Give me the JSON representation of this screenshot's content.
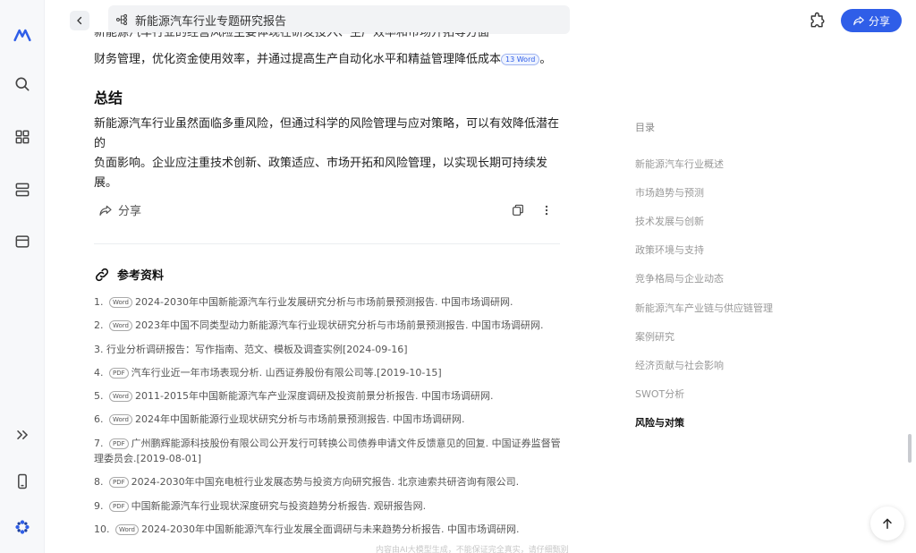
{
  "header": {
    "title": "新能源汽车行业专题研究报告",
    "share_label": "分享"
  },
  "article": {
    "cut_line": "新能源汽车行业的经营风险主要体现在研发投入、生产效率和市场开拓等方面",
    "para1_text": "财务管理，优化资金使用效率，并通过提高生产自动化水平和精益管理降低成本",
    "para1_cite": "13 Word",
    "summary_heading": "总结",
    "summary_line1": "新能源汽车行业虽然面临多重风险，但通过科学的风险管理与应对策略，可以有效降低潜在的",
    "summary_line2": "负面影响。企业应注重技术创新、政策适应、市场开拓和风险管理，以实现长期可持续发展。",
    "share_label": "分享"
  },
  "references": {
    "heading": "参考资料",
    "items": [
      {
        "num": "1.",
        "tag": "Word",
        "text": "2024-2030年中国新能源汽车行业发展研究分析与市场前景预测报告. 中国市场调研网."
      },
      {
        "num": "2.",
        "tag": "Word",
        "text": "2023年中国不同类型动力新能源汽车行业现状研究分析与市场前景预测报告. 中国市场调研网."
      },
      {
        "num": "3.",
        "tag": "",
        "text": "行业分析调研报告：写作指南、范文、模板及调查实例[2024-09-16]"
      },
      {
        "num": "4.",
        "tag": "PDF",
        "text": "汽车行业近一年市场表现分析. 山西证券股份有限公司等.[2019-10-15]"
      },
      {
        "num": "5.",
        "tag": "Word",
        "text": "2011-2015年中国新能源汽车产业深度调研及投资前景分析报告. 中国市场调研网."
      },
      {
        "num": "6.",
        "tag": "Word",
        "text": "2024年中国新能源行业现状研究分析与市场前景预测报告. 中国市场调研网."
      },
      {
        "num": "7.",
        "tag": "PDF",
        "text": "广州鹏辉能源科技股份有限公司公开发行可转换公司债券申请文件反馈意见的回复. 中国证券监督管",
        "text2": "理委员会.[2019-08-01]"
      },
      {
        "num": "8.",
        "tag": "PDF",
        "text": "2024-2030年中国充电桩行业发展态势与投资方向研究报告. 北京迪索共研咨询有限公司."
      },
      {
        "num": "9.",
        "tag": "PDF",
        "text": "中国新能源汽车行业现状深度研究与投资趋势分析报告. 观研报告网."
      },
      {
        "num": "10.",
        "tag": "Word",
        "text": "2024-2030年中国新能源汽车行业发展全面调研与未来趋势分析报告. 中国市场调研网."
      }
    ]
  },
  "footer_note": "内容由AI大模型生成，不能保证完全真实，请仔细甄别",
  "toc": {
    "title": "目录",
    "items": [
      {
        "label": "新能源汽车行业概述"
      },
      {
        "label": "市场趋势与预测"
      },
      {
        "label": "技术发展与创新"
      },
      {
        "label": "政策环境与支持"
      },
      {
        "label": "竞争格局与企业动态"
      },
      {
        "label": "新能源汽车产业链与供应链管理"
      },
      {
        "label": "案例研究"
      },
      {
        "label": "经济贡献与社会影响"
      },
      {
        "label": "SWOT分析"
      },
      {
        "label": "风险与对策"
      }
    ],
    "active_index": 9
  },
  "colors": {
    "accent": "#2f5ee8",
    "toc_active": "#111111",
    "toc_inactive": "#999999"
  },
  "icons": [
    "logo-icon",
    "search-icon",
    "grid-icon",
    "stack-icon",
    "window-icon",
    "expand-icon",
    "phone-icon",
    "flower-icon",
    "back-icon",
    "mindmap-icon",
    "plugin-icon",
    "share-icon",
    "copy-icon",
    "more-icon",
    "link-icon",
    "arrow-up-icon"
  ]
}
